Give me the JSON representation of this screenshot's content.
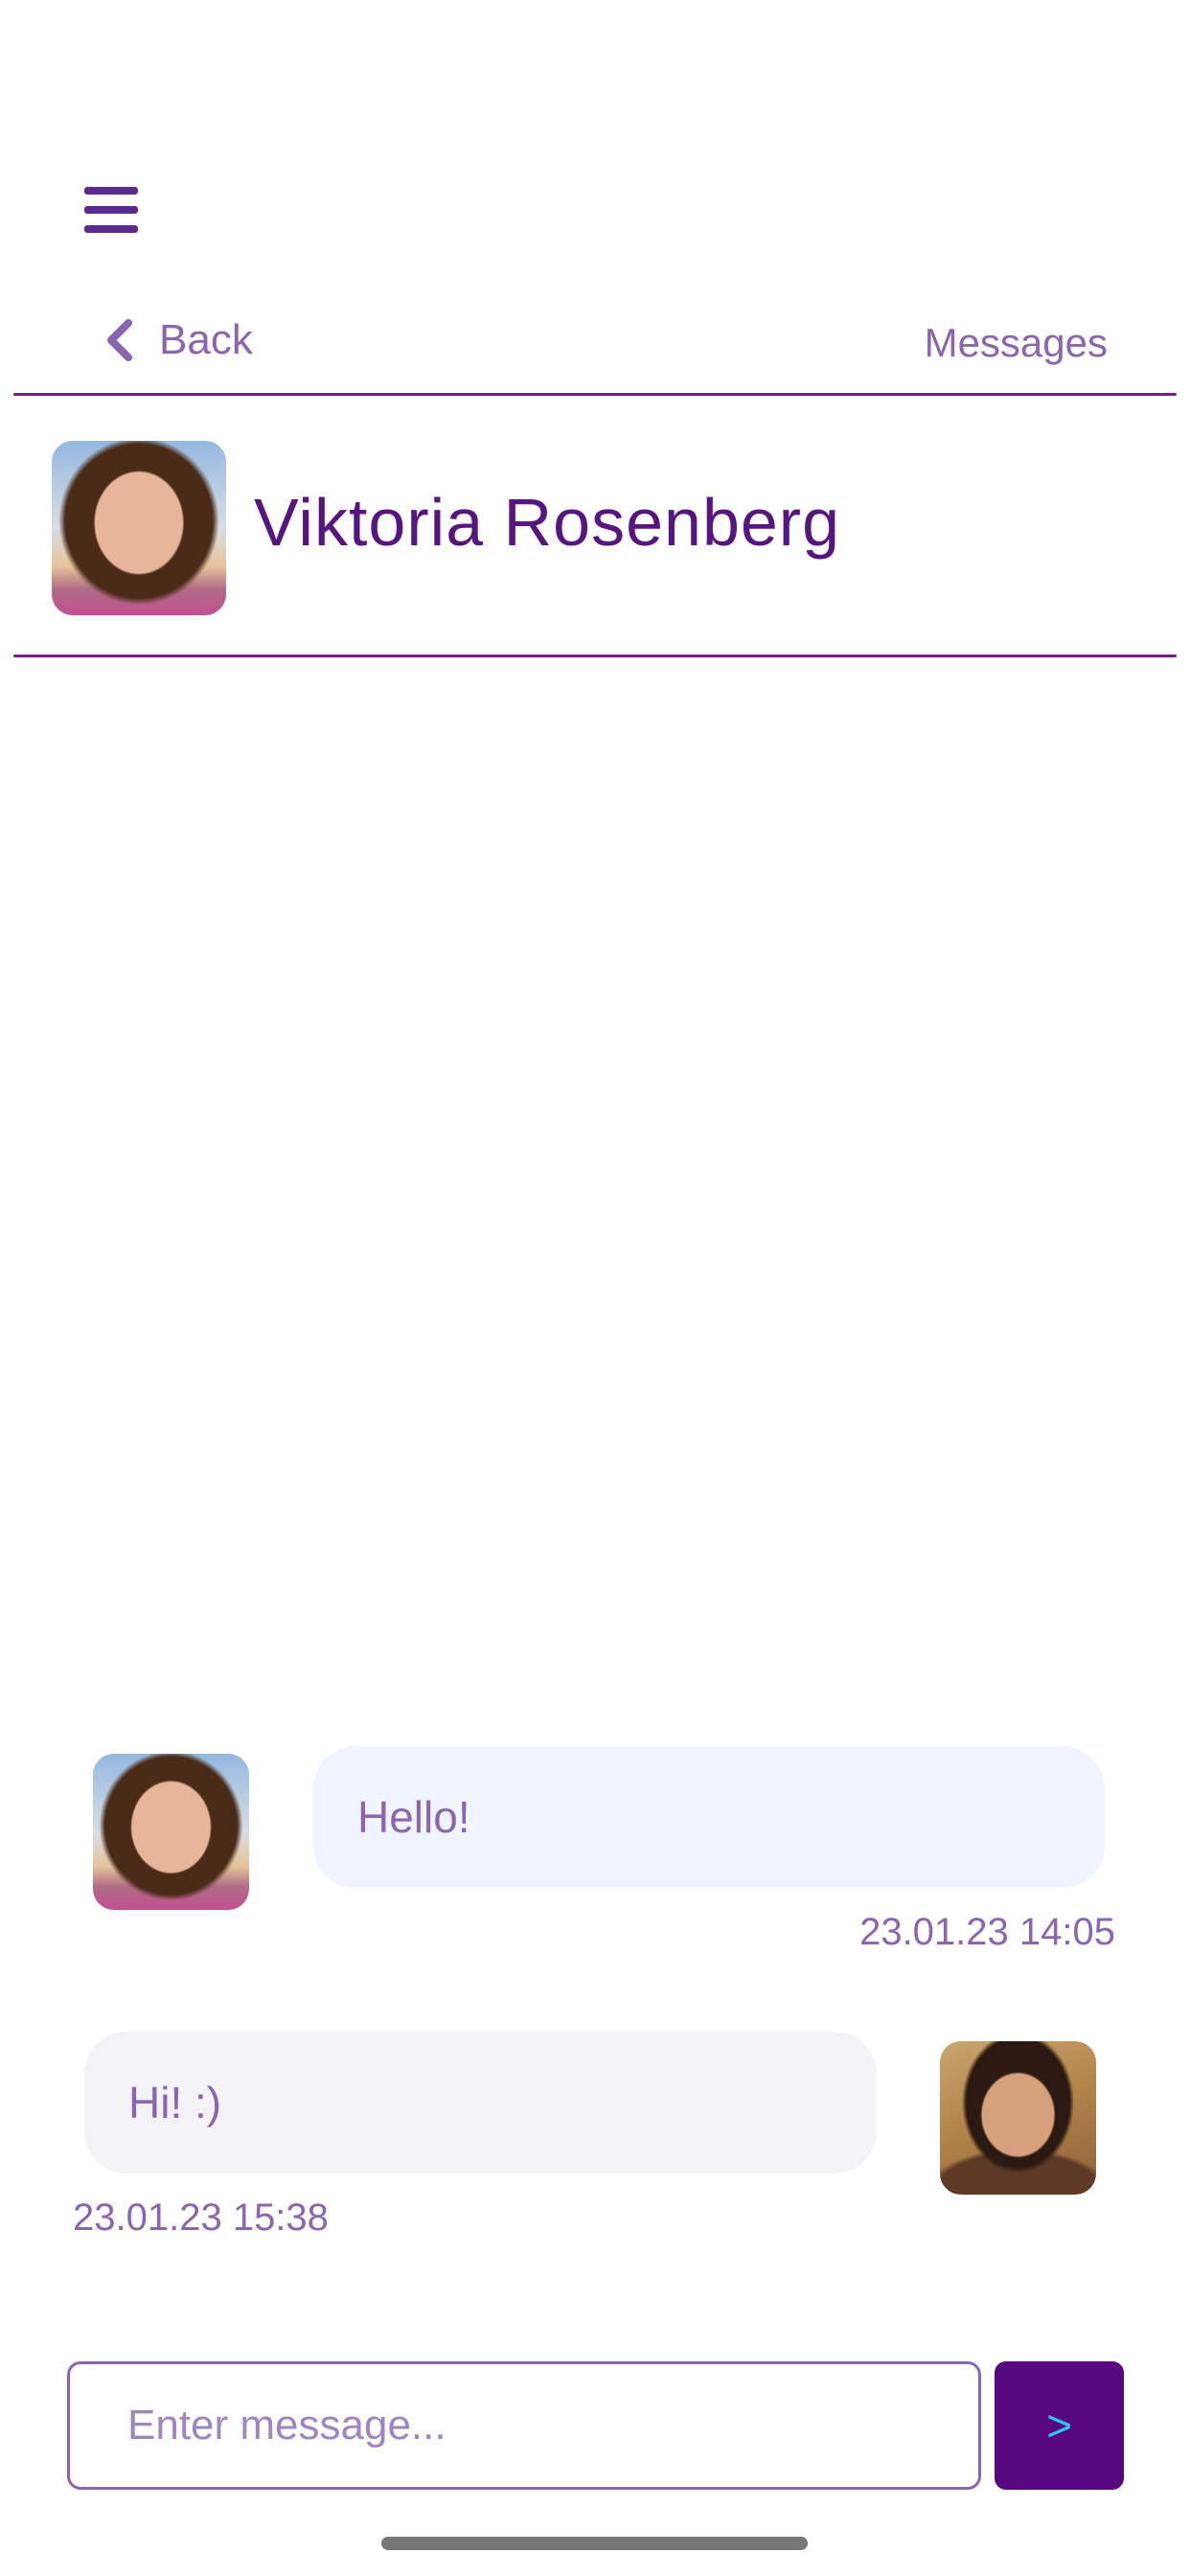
{
  "nav": {
    "menu_icon": "hamburger-icon",
    "back_icon": "chevron-left-icon",
    "back_label": "Back",
    "messages_label": "Messages"
  },
  "contact": {
    "name": "Viktoria Rosenberg"
  },
  "messages": [
    {
      "text": "Hello!",
      "timestamp": "23.01.23 14:05",
      "from": "contact"
    },
    {
      "text": "Hi! :)",
      "timestamp": "23.01.23 15:38",
      "from": "me"
    }
  ],
  "composer": {
    "placeholder": "Enter message...",
    "value": "",
    "send_label": ">"
  },
  "colors": {
    "accent": "#570780",
    "text_purple": "#57157f",
    "muted_purple": "#8a66b0",
    "incoming_bubble": "#f0f4fe",
    "outgoing_bubble": "#f3f3f6",
    "send_glyph": "#2ec6f0"
  }
}
